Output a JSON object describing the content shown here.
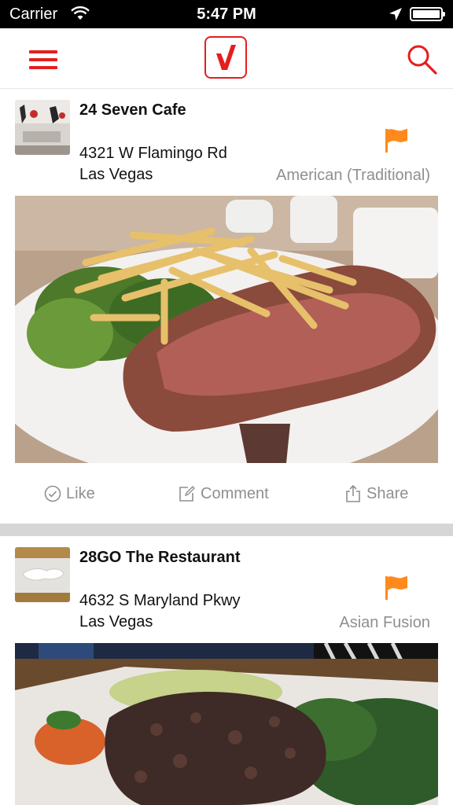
{
  "status_bar": {
    "carrier": "Carrier",
    "time": "5:47 PM"
  },
  "nav": {
    "logo_letter": "V",
    "accent_color": "#e41e1e"
  },
  "feed": [
    {
      "name": "24 Seven Cafe",
      "address_line1": "4321 W Flamingo Rd",
      "address_line2": "Las Vegas",
      "cuisine": "American (Traditional)",
      "flag_color": "#ff8a1c"
    },
    {
      "name": "28GO The Restaurant",
      "address_line1": "4632 S Maryland Pkwy",
      "address_line2": "Las Vegas",
      "cuisine": "Asian Fusion",
      "flag_color": "#ff8a1c"
    }
  ],
  "actions": {
    "like": "Like",
    "comment": "Comment",
    "share": "Share"
  }
}
